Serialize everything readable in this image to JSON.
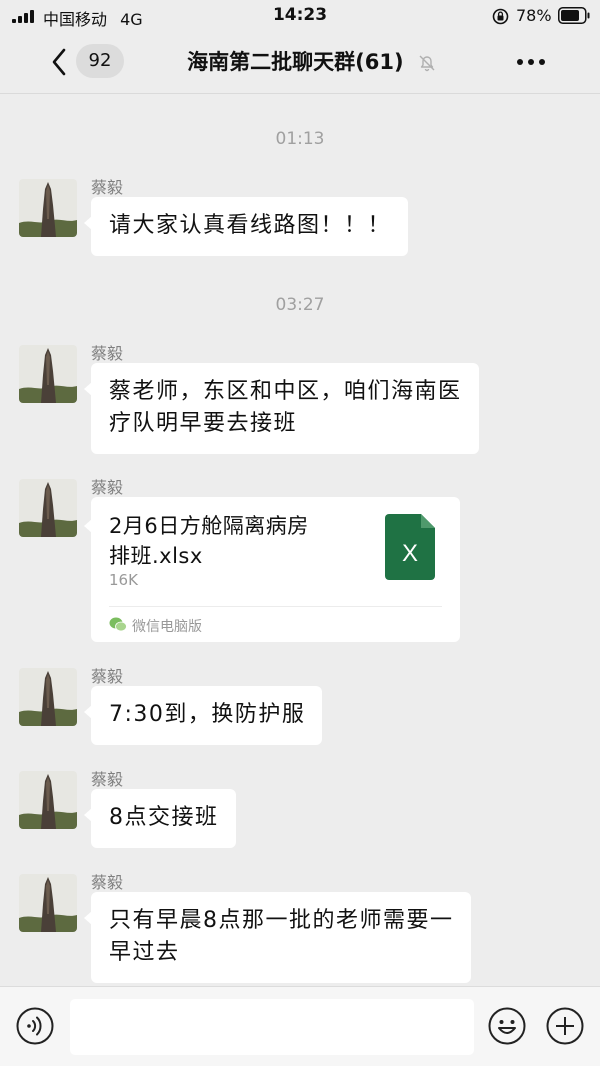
{
  "status_bar": {
    "carrier": "中国移动",
    "network": "4G",
    "time": "14:23",
    "battery": "78%"
  },
  "nav": {
    "unread_count": "92",
    "title": "海南第二批聊天群(61)",
    "icons": {
      "back": "chevron-left-icon",
      "mute": "bell-off-icon",
      "more": "ellipsis-icon"
    }
  },
  "messages": {
    "time_1": "01:13",
    "time_2": "03:27",
    "msg1": {
      "sender": "蔡毅",
      "text": "请大家认真看线路图！！！"
    },
    "msg2": {
      "sender": "蔡毅",
      "line1": "蔡老师，东区和中区，咱们海南医",
      "line2": "疗队明早要去接班"
    },
    "msg3": {
      "sender": "蔡毅",
      "file_name_line1": "2月6日方舱隔离病房",
      "file_name_line2": "排班.xlsx",
      "file_size": "16K",
      "file_icon_letter": "X",
      "source": "微信电脑版"
    },
    "msg4": {
      "sender": "蔡毅",
      "text": "7:30到，换防护服"
    },
    "msg5": {
      "sender": "蔡毅",
      "text": "8点交接班"
    },
    "msg6": {
      "sender": "蔡毅",
      "line1": "只有早晨8点那一批的老师需要一",
      "line2": "早过去"
    }
  },
  "input_bar": {
    "input_value": "",
    "icons": {
      "voice": "voice-icon",
      "emoji": "emoji-icon",
      "plus": "plus-icon"
    }
  },
  "colors": {
    "background": "#ededed",
    "bubble": "#ffffff",
    "excel_green": "#1f7244",
    "meta_text": "#a0a0a0"
  }
}
